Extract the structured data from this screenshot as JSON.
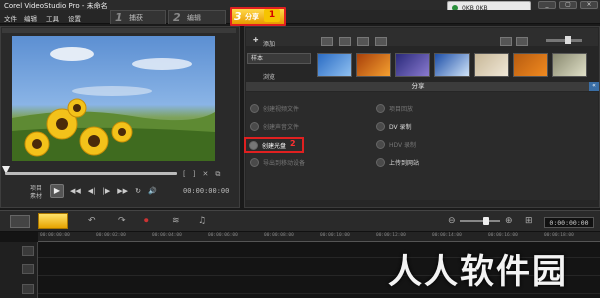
{
  "window": {
    "title": "Corel VideoStudio Pro - 未命名",
    "disk_badge": "0KB 0KB",
    "buttons": [
      "_",
      "▢",
      "×"
    ]
  },
  "menu": [
    "文件",
    "编辑",
    "工具",
    "设置"
  ],
  "steps": [
    {
      "num": "1",
      "label": "捕获"
    },
    {
      "num": "2",
      "label": "编辑"
    },
    {
      "num": "3",
      "label": "分享",
      "marker": "1"
    }
  ],
  "preview": {
    "clip_labels": [
      "项目",
      "素材"
    ],
    "play_icon": "▶",
    "transport": [
      "◀◀",
      "◀|",
      "|▶",
      "▶▶",
      "↻",
      "🔊"
    ],
    "timecode": "00:00:00:00",
    "scrub_right": [
      "[",
      "]",
      "✕",
      "⧉"
    ]
  },
  "library": {
    "add_label": "添加",
    "select_value": "样本",
    "browse_label": "浏览"
  },
  "share": {
    "bar_title": "分享",
    "options_left": [
      {
        "label": "创建视频文件",
        "dim": true
      },
      {
        "label": "创建声音文件",
        "dim": true
      },
      {
        "label": "创建光盘",
        "dim": false,
        "marker": "2"
      },
      {
        "label": "导出到移动设备",
        "dim": true
      }
    ],
    "options_right": [
      {
        "label": "项目回放",
        "dim": true
      },
      {
        "label": "DV 录制",
        "dim": false
      },
      {
        "label": "HDV 录制",
        "dim": true
      },
      {
        "label": "上传到网站",
        "dim": false
      }
    ]
  },
  "timeline": {
    "timecode": "0:00:00:00",
    "ruler": [
      "00:00:00:00",
      "00:00:02:00",
      "00:00:04:00",
      "00:00:06:00",
      "00:00:08:00",
      "00:00:10:00",
      "00:00:12:00",
      "00:00:14:00",
      "00:00:16:00",
      "00:00:18:00"
    ]
  },
  "watermark": "人人软件园",
  "colors": {
    "accent": "#f2b800",
    "highlight": "#e02020"
  }
}
